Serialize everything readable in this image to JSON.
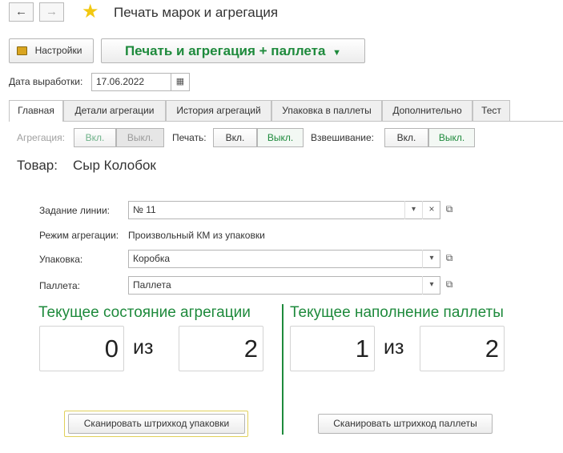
{
  "window": {
    "title": "Печать марок и агрегация",
    "back_icon": "arrow-left-icon",
    "forward_icon": "arrow-right-icon",
    "favorite_icon": "star-icon"
  },
  "toolbar": {
    "settings_label": "Настройки",
    "main_action_label": "Печать и агрегация + паллета"
  },
  "production_date": {
    "label": "Дата выработки:",
    "value": "17.06.2022"
  },
  "tabs": [
    {
      "label": "Главная",
      "active": true
    },
    {
      "label": "Детали агрегации"
    },
    {
      "label": "История агрегаций"
    },
    {
      "label": "Упаковка в паллеты"
    },
    {
      "label": "Дополнительно"
    },
    {
      "label": "Тест"
    }
  ],
  "toggles": {
    "aggregation": {
      "label": "Агрегация:",
      "on": "Вкл.",
      "off": "Выкл."
    },
    "print": {
      "label": "Печать:",
      "on": "Вкл.",
      "off": "Выкл."
    },
    "weighing": {
      "label": "Взвешивание:",
      "on": "Вкл.",
      "off": "Выкл."
    }
  },
  "product": {
    "label": "Товар:",
    "value": "Сыр Колобок"
  },
  "form": {
    "line_task": {
      "label": "Задание линии:",
      "value": "№ 11"
    },
    "aggregation_mode": {
      "label": "Режим агрегации:",
      "value": "Произвольный КМ из упаковки"
    },
    "package": {
      "label": "Упаковка:",
      "value": "Коробка"
    },
    "pallet": {
      "label": "Паллета:",
      "value": "Паллета"
    }
  },
  "aggregation_state": {
    "title": "Текущее состояние агрегации",
    "current": "0",
    "of": "из",
    "total": "2",
    "scan_button": "Сканировать штрихкод упаковки"
  },
  "pallet_state": {
    "title": "Текущее наполнение паллеты",
    "current": "1",
    "of": "из",
    "total": "2",
    "scan_button": "Сканировать штрихкод паллеты"
  },
  "colors": {
    "accent_green": "#1e8a3c",
    "star": "#f2c811"
  }
}
